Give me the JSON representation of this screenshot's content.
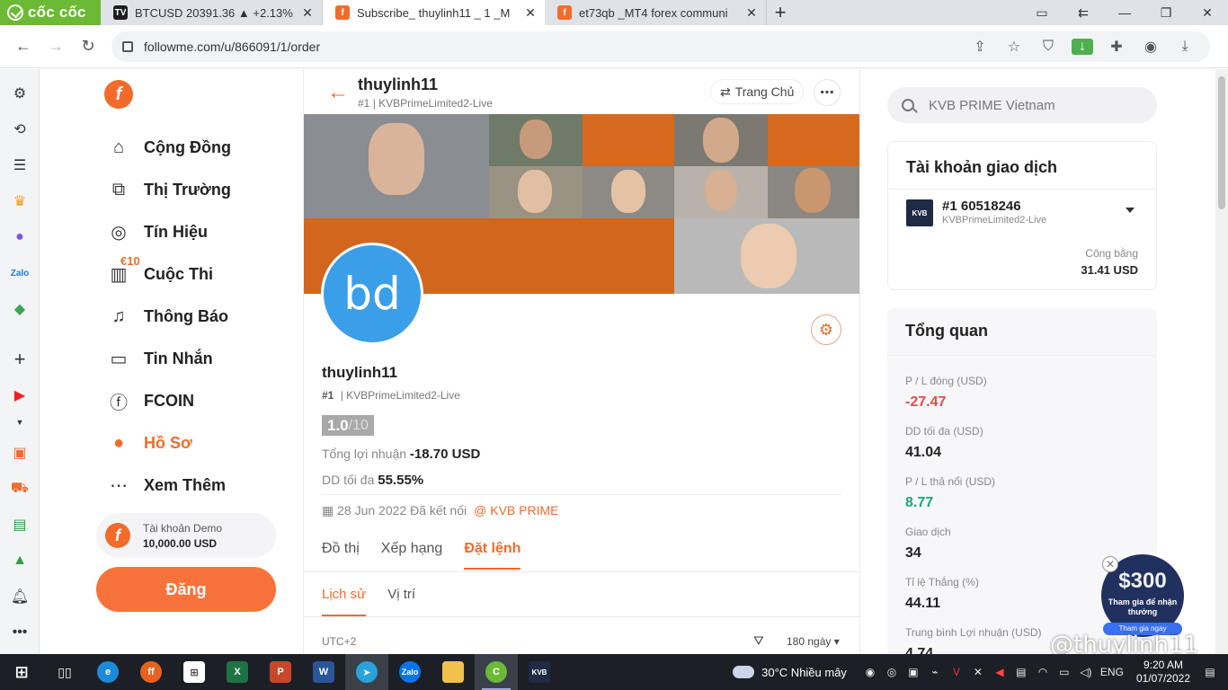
{
  "browser": {
    "brand": "cốc cốc",
    "tabs": [
      {
        "title": "BTCUSD 20391.36 ▲ +2.13%",
        "favicon": "tv",
        "close": "✕"
      },
      {
        "title": "Subscribe_ thuylinh11 _ 1 _M",
        "favicon": "f",
        "close": "✕"
      },
      {
        "title": "et73qb _MT4 forex communi",
        "favicon": "f",
        "close": "✕"
      }
    ],
    "new_tab": "+",
    "url": "followme.com/u/866091/1/order"
  },
  "nav": {
    "items": [
      {
        "label": "Cộng Đồng",
        "icon": "home-icon"
      },
      {
        "label": "Thị Trường",
        "icon": "chart-icon"
      },
      {
        "label": "Tín Hiệu",
        "icon": "signal-icon"
      },
      {
        "label": "Cuộc Thi",
        "icon": "contest-icon"
      },
      {
        "label": "Thông Báo",
        "icon": "bell-icon"
      },
      {
        "label": "Tin Nhắn",
        "icon": "message-icon"
      },
      {
        "label": "FCOIN",
        "icon": "fcoin-icon"
      },
      {
        "label": "Hồ Sơ",
        "icon": "profile-icon"
      },
      {
        "label": "Xem Thêm",
        "icon": "more-icon"
      }
    ],
    "contest_badge": "€10",
    "demo_label": "Tài khoản Demo",
    "demo_balance": "10,000.00 USD",
    "post_button": "Đăng"
  },
  "profile": {
    "header_name": "thuylinh11",
    "header_rank": "#1",
    "header_server": "KVBPrimeLimited2-Live",
    "home_button": "Trang Chủ",
    "avatar_text": "bd",
    "name": "thuylinh11",
    "rank": "#1",
    "server": "KVBPrimeLimited2-Live",
    "score": "1.0",
    "score_max": "/10",
    "total_profit_label": "Tổng lợi nhuận",
    "total_profit_value": "-18.70 USD",
    "max_dd_label": "DD tối đa",
    "max_dd_value": "55.55%",
    "connected_text": "28 Jun 2022 Đã kết nối",
    "broker": "@ KVB PRIME",
    "tabs": [
      "Đồ thị",
      "Xếp hạng",
      "Đặt lệnh"
    ],
    "subtabs": [
      "Lịch sử",
      "Vị trí"
    ],
    "timezone": "UTC+2",
    "period": "180 ngày"
  },
  "right": {
    "search_placeholder": "KVB PRIME Vietnam",
    "account_title": "Tài khoản giao dịch",
    "account_no": "#1  60518246",
    "account_server": "KVBPrimeLimited2-Live",
    "equity_label": "Công bằng",
    "equity_value": "31.41 USD",
    "overview_title": "Tổng quan",
    "overview": [
      {
        "label": "P / L đóng (USD)",
        "value": "-27.47",
        "tone": "red"
      },
      {
        "label": "DD tối đa (USD)",
        "value": "41.04",
        "tone": "normal"
      },
      {
        "label": "P / L thả nổi (USD)",
        "value": "8.77",
        "tone": "green"
      },
      {
        "label": "Giao dịch",
        "value": "34",
        "tone": "normal"
      },
      {
        "label": "Tỉ lệ Thắng (%)",
        "value": "44.11",
        "tone": "normal"
      },
      {
        "label": "Trung bình Lợi nhuận (USD)",
        "value": "4.74",
        "tone": "normal"
      }
    ],
    "promo_amount": "$300",
    "promo_text": "Tham gia để nhận thưởng",
    "promo_join": "Tham gia ngay"
  },
  "watermark": "@thuylinh11",
  "taskbar": {
    "weather": "30°C  Nhiều mây",
    "lang": "ENG",
    "time": "9:20 AM",
    "date": "01/07/2022"
  },
  "colors": {
    "accent": "#f26b2b",
    "avatar": "#3b9ee8",
    "loss": "#e84a4a",
    "gain": "#1aa67a"
  }
}
